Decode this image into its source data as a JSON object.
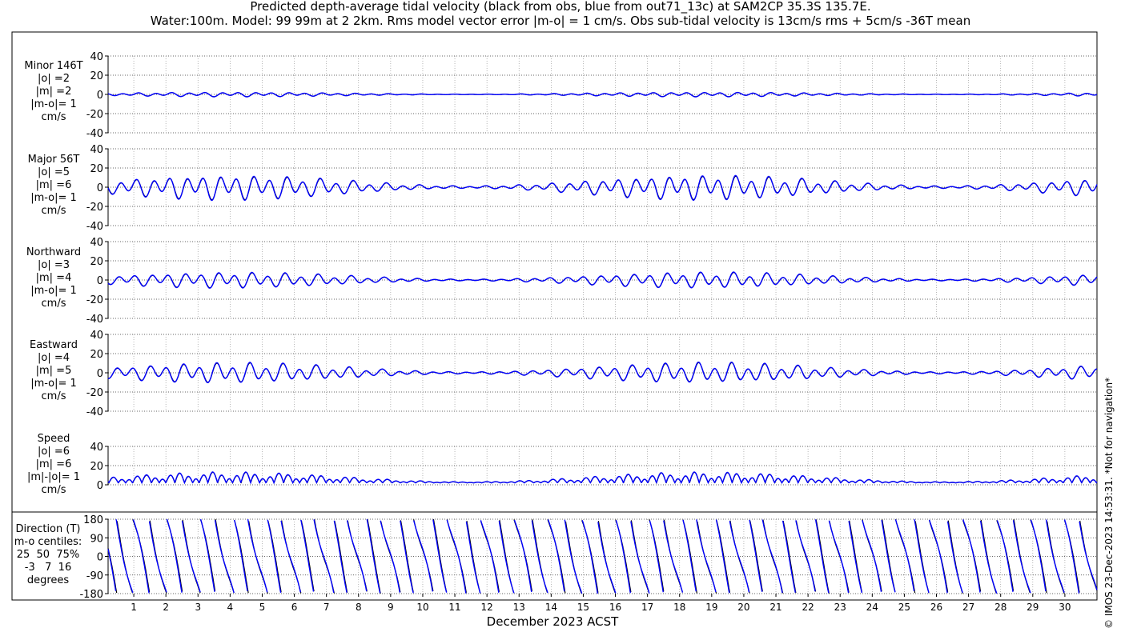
{
  "title_line1": "Predicted depth-average tidal velocity (black from obs, blue from out71_13c) at SAM2CP 35.3S 135.7E.",
  "title_line2": "Water:100m. Model: 99 99m at 2 2km. Rms model vector error |m-o| = 1 cm/s. Obs sub-tidal velocity is 13cm/s rms + 5cm/s -36T mean",
  "xlabel": "December 2023 ACST",
  "side_note": "© IMOS 23-Dec-2023 14:53:31. *Not for navigation*",
  "colors": {
    "obs": "#000000",
    "model": "#0000ff"
  },
  "chart_data": [
    {
      "type": "line",
      "label_lines": [
        "Minor 146T",
        "|o| =2",
        "|m| =2",
        "|m-o|= 1",
        "cm/s"
      ],
      "ylim": [
        -40,
        40
      ],
      "yticks": [
        -40,
        -20,
        0,
        20,
        40
      ],
      "amplitude": 2,
      "series": [
        {
          "name": "obs"
        },
        {
          "name": "model"
        }
      ]
    },
    {
      "type": "line",
      "label_lines": [
        "Major 56T",
        "|o| =5",
        "|m| =6",
        "|m-o|= 1",
        "cm/s"
      ],
      "ylim": [
        -40,
        40
      ],
      "yticks": [
        -40,
        -20,
        0,
        20,
        40
      ],
      "amplitude": 11,
      "series": [
        {
          "name": "obs"
        },
        {
          "name": "model"
        }
      ]
    },
    {
      "type": "line",
      "label_lines": [
        "Northward",
        "|o| =3",
        "|m| =4",
        "|m-o|= 1",
        "cm/s"
      ],
      "ylim": [
        -40,
        40
      ],
      "yticks": [
        -40,
        -20,
        0,
        20,
        40
      ],
      "amplitude": 7,
      "series": [
        {
          "name": "obs"
        },
        {
          "name": "model"
        }
      ]
    },
    {
      "type": "line",
      "label_lines": [
        "Eastward",
        "|o| =4",
        "|m| =5",
        "|m-o|= 1",
        "cm/s"
      ],
      "ylim": [
        -40,
        40
      ],
      "yticks": [
        -40,
        -20,
        0,
        20,
        40
      ],
      "amplitude": 9,
      "series": [
        {
          "name": "obs"
        },
        {
          "name": "model"
        }
      ]
    },
    {
      "type": "line",
      "label_lines": [
        "Speed",
        "|o| =6",
        "|m| =6",
        "|m|-|o|= 1",
        "cm/s"
      ],
      "ylim": [
        0,
        40
      ],
      "yticks": [
        0,
        20,
        40
      ],
      "amplitude": 10,
      "series": [
        {
          "name": "obs"
        },
        {
          "name": "model"
        }
      ]
    },
    {
      "type": "line",
      "label_lines": [
        "Direction (T)",
        "m-o centiles:",
        "25  50  75%",
        "-3   7  16",
        "degrees"
      ],
      "ylim": [
        -180,
        180
      ],
      "yticks": [
        -180,
        -90,
        0,
        90,
        180
      ],
      "series": [
        {
          "name": "obs"
        },
        {
          "name": "model"
        }
      ]
    }
  ],
  "x_axis": {
    "start_day": 0.2,
    "end_day": 31.0,
    "tick_labels": [
      "1",
      "2",
      "3",
      "4",
      "5",
      "6",
      "7",
      "8",
      "9",
      "10",
      "11",
      "12",
      "13",
      "14",
      "15",
      "16",
      "17",
      "18",
      "19",
      "20",
      "21",
      "22",
      "23",
      "24",
      "25",
      "26",
      "27",
      "28",
      "29",
      "30"
    ]
  }
}
